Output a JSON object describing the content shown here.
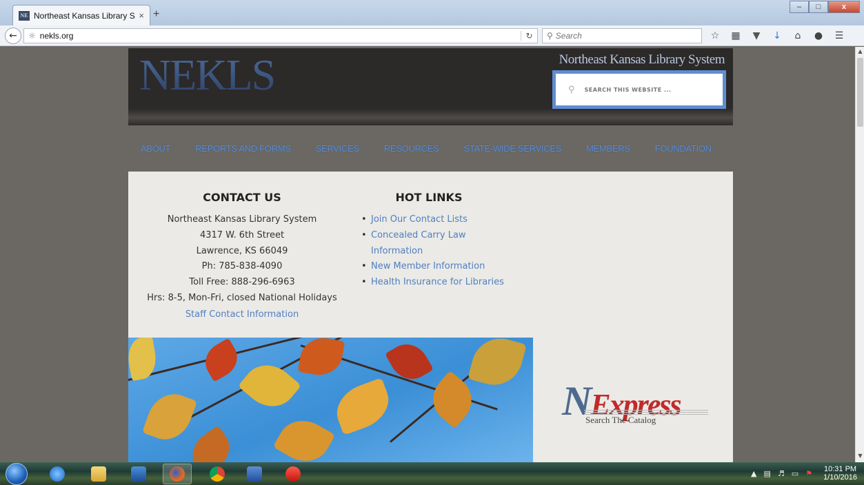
{
  "browser": {
    "tab_title": "Northeast Kansas Library S...",
    "tab_favicon": "NE",
    "tab_close": "×",
    "new_tab": "+",
    "url": "nekls.org",
    "search_placeholder": "Search",
    "window_buttons": {
      "minimize": "–",
      "maximize": "□",
      "close": "x"
    }
  },
  "header": {
    "logo": "NEKLS",
    "site_name": "Northeast Kansas Library System",
    "search_placeholder": "SEARCH THIS WEBSITE ..."
  },
  "nav": {
    "items": [
      "ABOUT",
      "REPORTS AND FORMS",
      "SERVICES",
      "RESOURCES",
      "STATE-WIDE SERVICES",
      "MEMBERS",
      "FOUNDATION"
    ]
  },
  "contact": {
    "heading": "CONTACT US",
    "lines": [
      "Northeast Kansas Library System",
      "4317 W. 6th Street",
      "Lawrence, KS 66049",
      "Ph: 785-838-4090",
      "Toll Free: 888-296-6963",
      "Hrs: 8-5, Mon-Fri, closed National Holidays"
    ],
    "staff_link": "Staff Contact Information"
  },
  "hot_links": {
    "heading": "HOT LINKS",
    "items": [
      "Join Our Contact Lists",
      "Concealed Carry Law Information",
      "New Member Information",
      "Health Insurance for Libraries"
    ]
  },
  "nexpress": {
    "logo_n": "N",
    "logo_rest": "Express",
    "subtitle": "Search The Catalog"
  },
  "taskbar": {
    "time": "10:31 PM",
    "date": "1/10/2016"
  },
  "colors": {
    "page_bg": "#6b6863",
    "link": "#4f7fc1",
    "nav_link": "#5f8fd3",
    "header_bg": "#2c2929",
    "search_frame": "#5f8ed2",
    "content_bg": "#ebeae6",
    "nexpress_red": "#c12a2a"
  }
}
